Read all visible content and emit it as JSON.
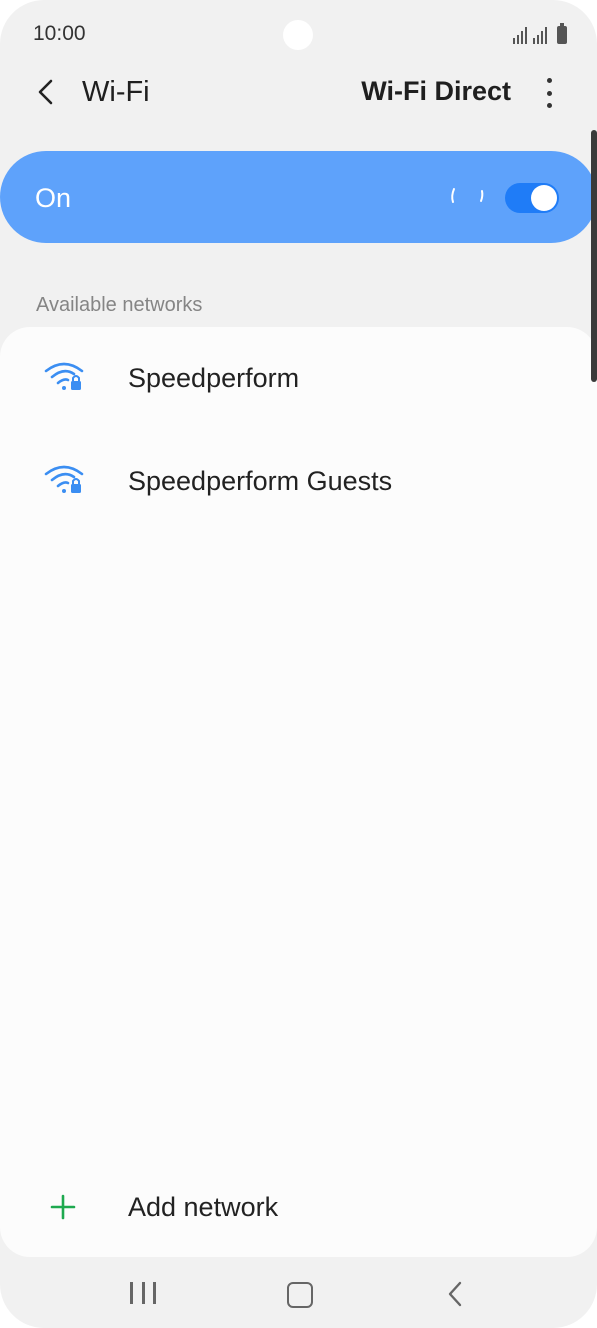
{
  "status_bar": {
    "time": "10:00"
  },
  "header": {
    "title": "Wi-Fi",
    "wifi_direct_label": "Wi-Fi Direct"
  },
  "master_toggle": {
    "label": "On",
    "state": "on",
    "accent": "#1f7cf7",
    "bar_color": "#5ea2fb"
  },
  "networks_section": {
    "label": "Available networks",
    "items": [
      {
        "name": "Speedperform",
        "icon": "wifi-locked-icon"
      },
      {
        "name": "Speedperform Guests",
        "icon": "wifi-locked-icon"
      }
    ]
  },
  "add_network": {
    "label": "Add network",
    "icon": "plus-icon",
    "icon_color": "#1ea94f"
  },
  "nav_bar": {
    "recent_icon": "recent-apps-icon",
    "home_icon": "home-icon",
    "back_icon": "back-icon"
  }
}
